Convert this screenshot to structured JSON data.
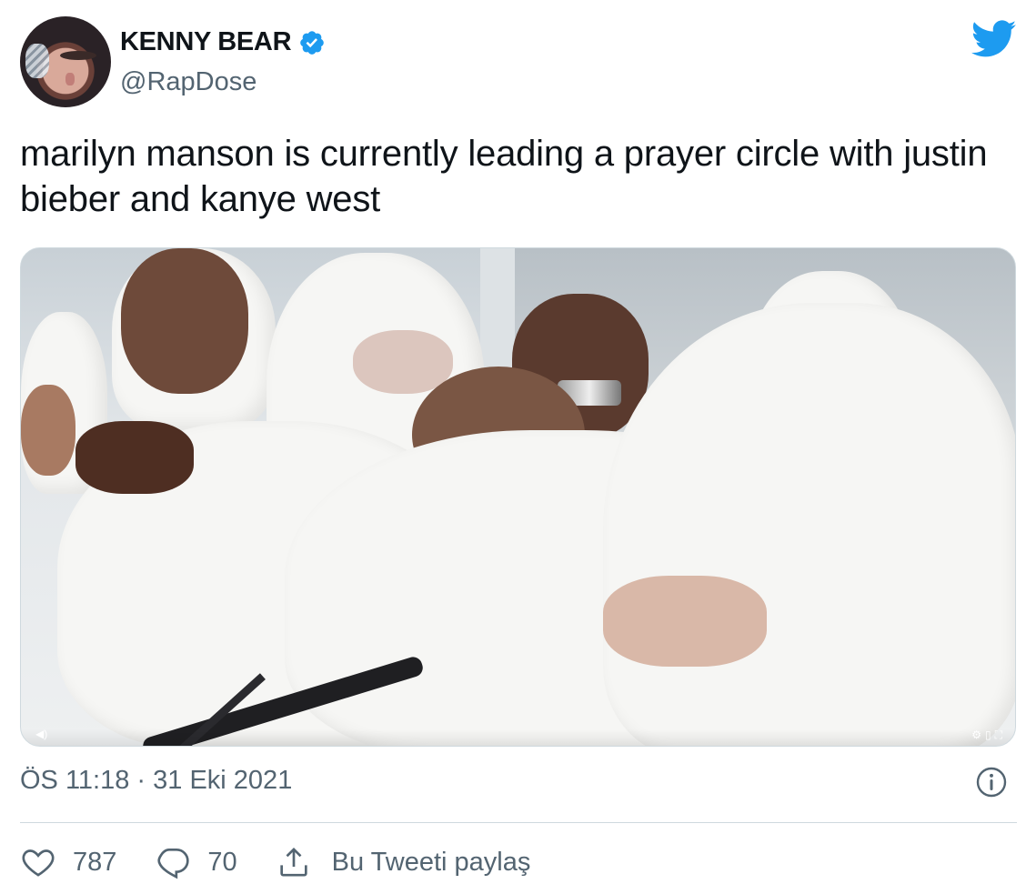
{
  "author": {
    "name": "KENNY BEAR",
    "handle": "@RapDose",
    "verified": true
  },
  "tweet": {
    "text": "marilyn manson is currently leading a prayer circle with justin bieber and kanye west",
    "timestamp": "ÖS 11:18 · 31 Eki 2021"
  },
  "media": {
    "type": "video",
    "icons": [
      "volume-icon",
      "settings-icon",
      "fullscreen-icon"
    ]
  },
  "actions": {
    "likes": "787",
    "replies": "70",
    "share_label": "Bu Tweeti paylaş"
  },
  "colors": {
    "twitter_blue": "#1d9bf0",
    "text_primary": "#0f1419",
    "text_secondary": "#536471",
    "border": "#cfd9de"
  }
}
